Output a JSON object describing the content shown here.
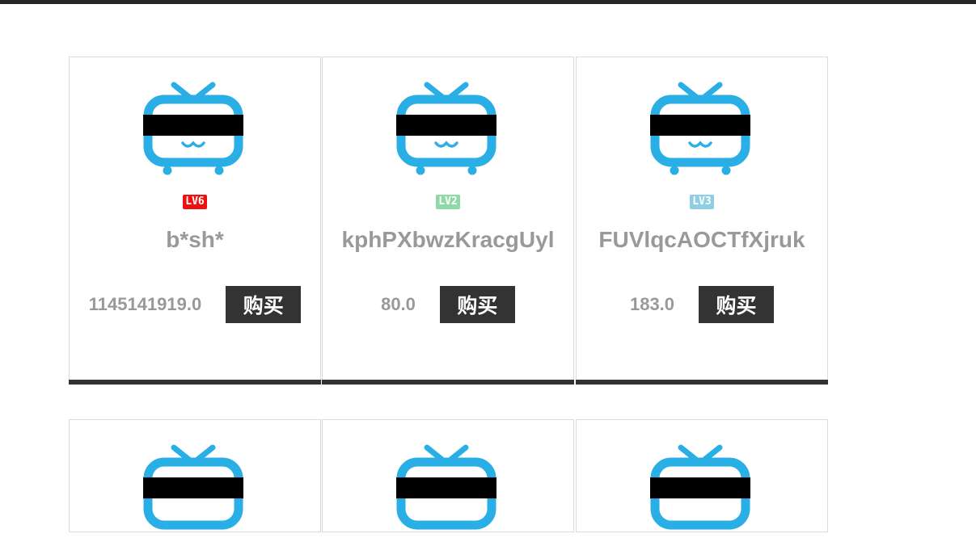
{
  "colors": {
    "tv_blue": "#2aaee6",
    "button_bg": "#333333",
    "text_gray": "#999999"
  },
  "cards": [
    {
      "username": "b*sh*",
      "level": "LV6",
      "level_color": "#ee1111",
      "price": "1145141919.0",
      "buy_label": "购买"
    },
    {
      "username": "kphPXbwzKracgUyl",
      "level": "LV2",
      "level_color": "#8dd9a8",
      "price": "80.0",
      "buy_label": "购买"
    },
    {
      "username": "FUVlqcAOCTfXjruk",
      "level": "LV3",
      "level_color": "#8ecfe6",
      "price": "183.0",
      "buy_label": "购买"
    }
  ]
}
